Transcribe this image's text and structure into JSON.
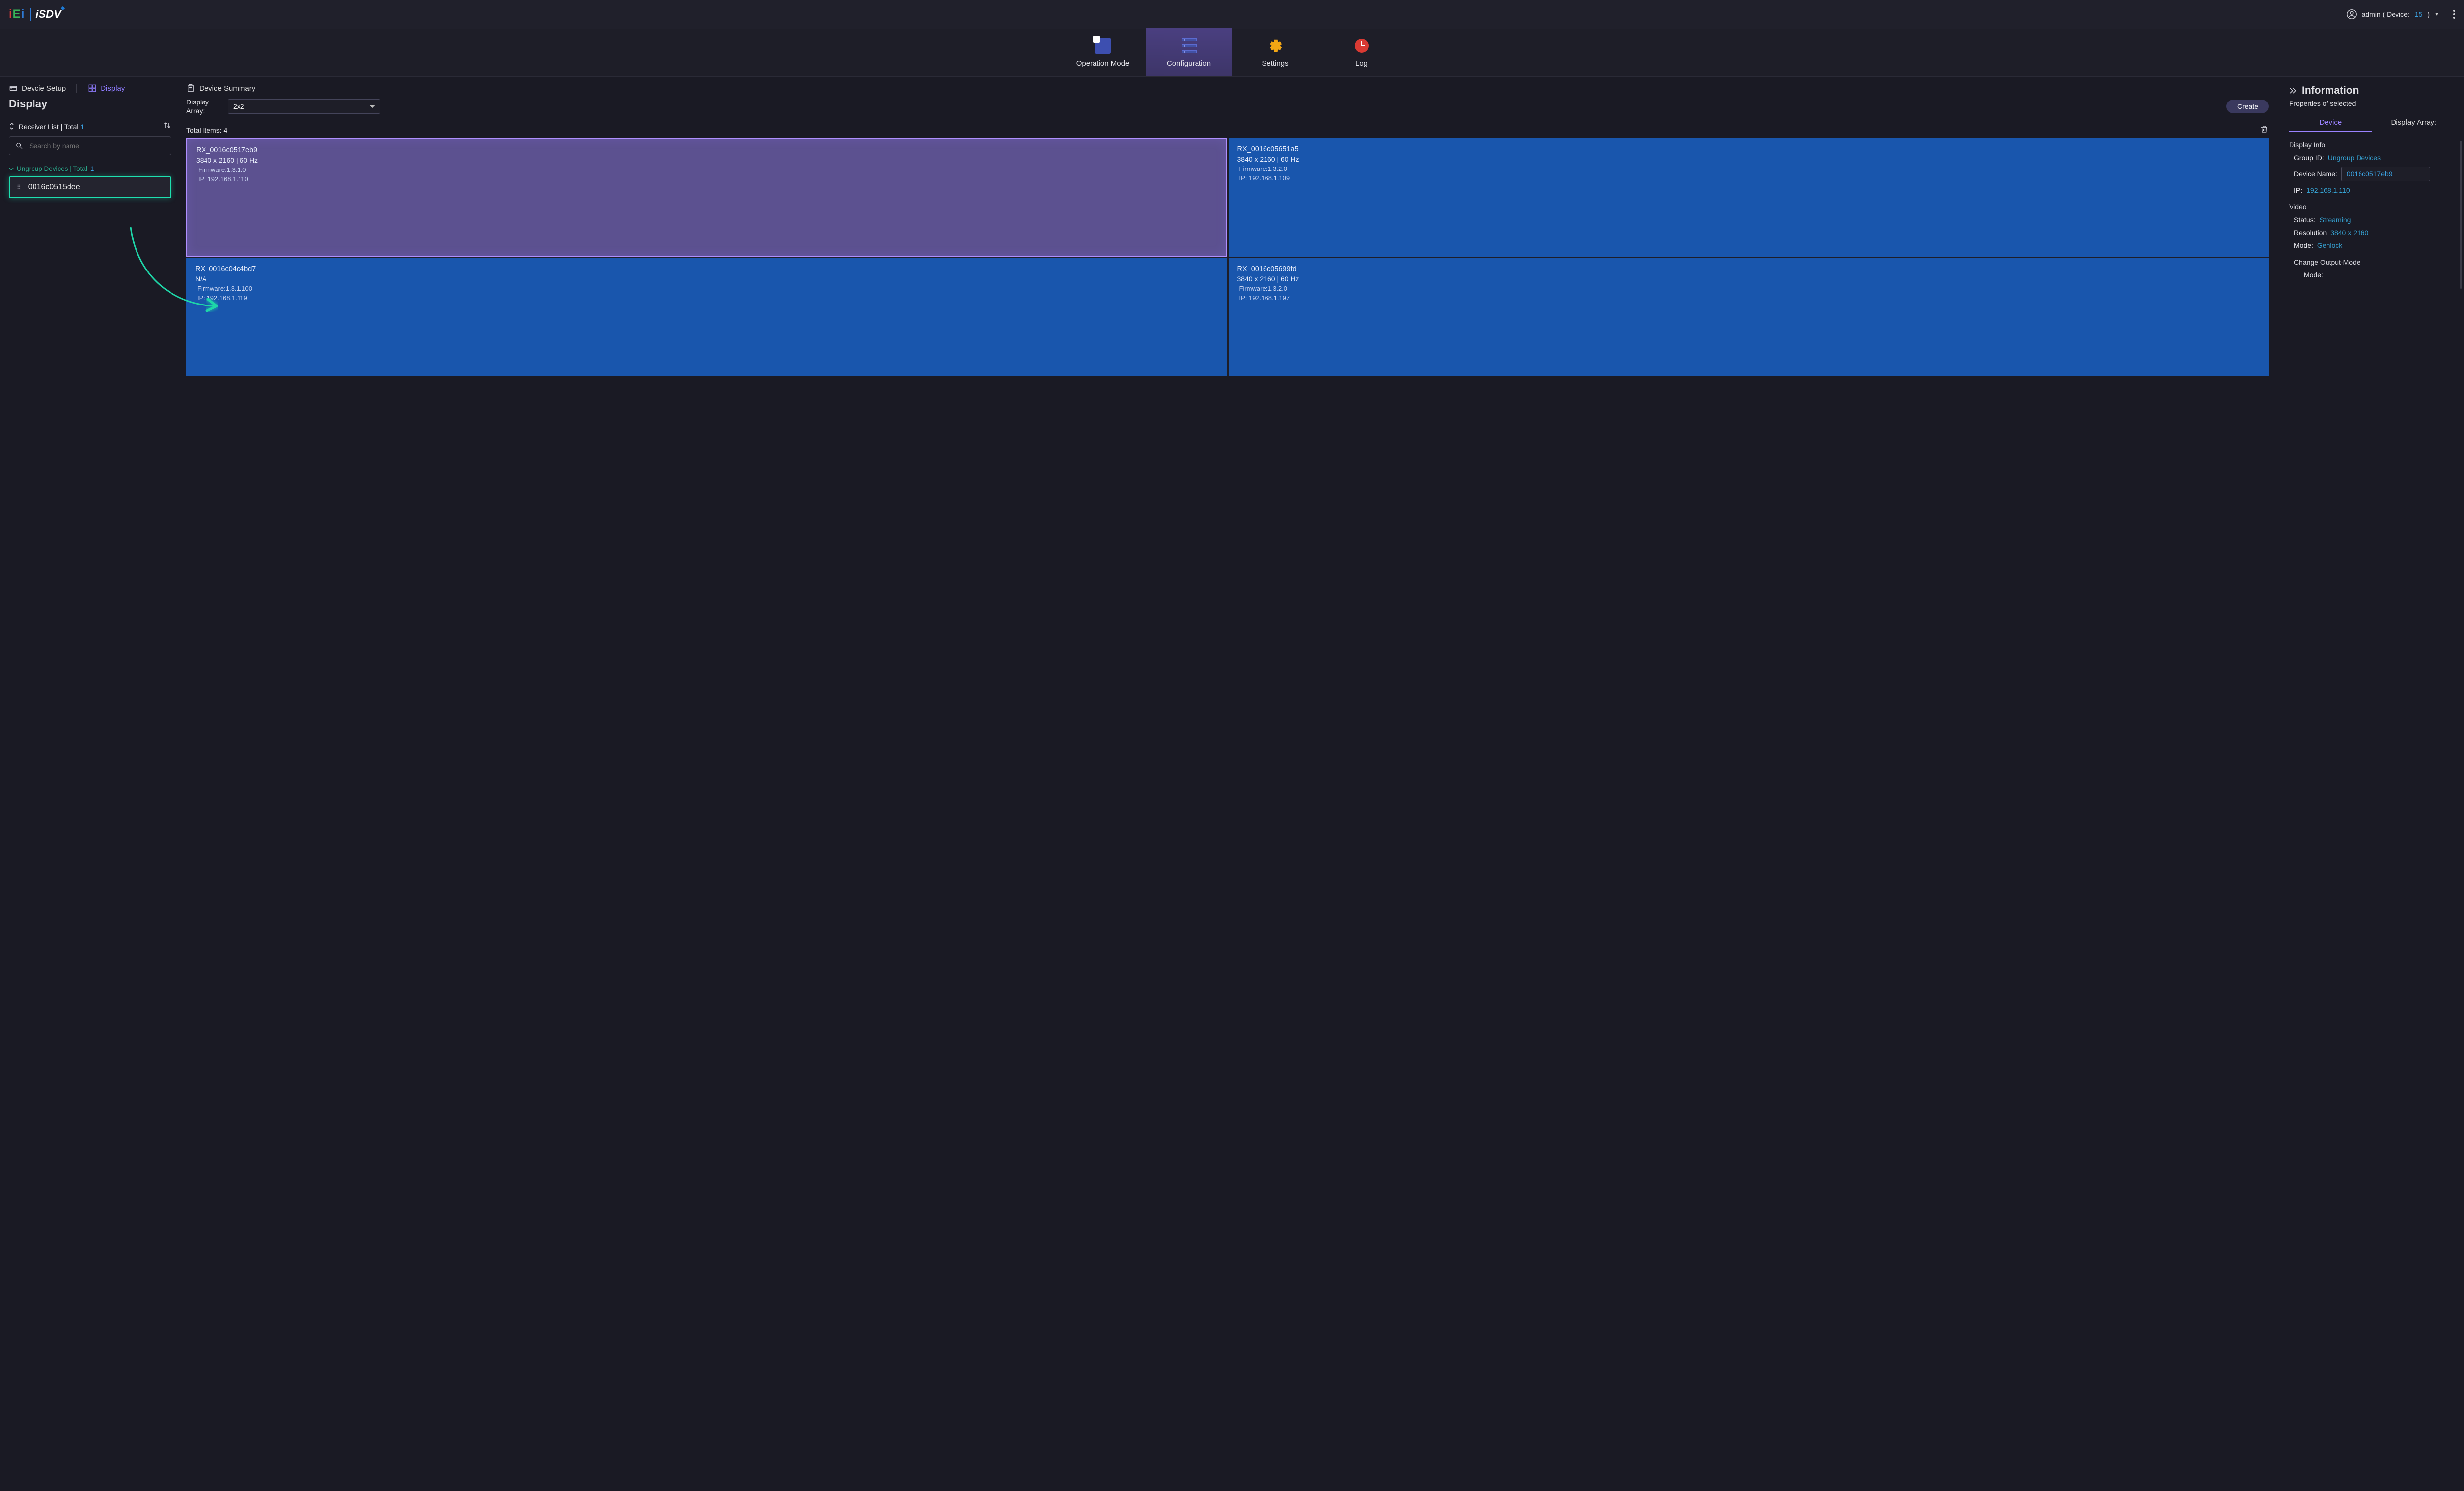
{
  "topbar": {
    "user_prefix": "admin ( Device:",
    "device_count": "15",
    "user_suffix": ")"
  },
  "mainnav": {
    "operation_mode": "Operation Mode",
    "configuration": "Configuration",
    "settings": "Settings",
    "log": "Log"
  },
  "subtabs": {
    "device_setup": "Devcie Setup",
    "display": "Display",
    "device_summary": "Device Summary"
  },
  "sidebar": {
    "title": "Display",
    "receiver_list_label": "Receiver List | Total",
    "receiver_total": "1",
    "search_placeholder": "Search by name",
    "group_label": "Ungroup Devices | Total",
    "group_total": "1",
    "device_name": "0016c0515dee"
  },
  "center": {
    "display_array_label": "Display Array:",
    "display_array_value": "2x2",
    "create_btn": "Create",
    "total_items_label": "Total Items:",
    "total_items_value": "4",
    "cells": [
      {
        "name": "RX_0016c0517eb9",
        "res": "3840 x 2160 | 60 Hz",
        "fw": "Firmware:1.3.1.0",
        "ip": "IP: 192.168.1.110",
        "selected": true
      },
      {
        "name": "RX_0016c05651a5",
        "res": "3840 x 2160 | 60 Hz",
        "fw": "Firmware:1.3.2.0",
        "ip": "IP: 192.168.1.109",
        "selected": false
      },
      {
        "name": "RX_0016c04c4bd7",
        "res": "N/A",
        "fw": "Firmware:1.3.1.100",
        "ip": "IP: 192.168.1.119",
        "selected": false
      },
      {
        "name": "RX_0016c05699fd",
        "res": "3840 x 2160 | 60 Hz",
        "fw": "Firmware:1.3.2.0",
        "ip": "IP: 192.168.1.197",
        "selected": false
      }
    ]
  },
  "info": {
    "heading": "Information",
    "subtitle": "Properties of selected",
    "tab_device": "Device",
    "tab_array": "Display Array:",
    "display_info_label": "Display Info",
    "group_id_k": "Group ID:",
    "group_id_v": "Ungroup Devices",
    "device_name_k": "Device Name:",
    "device_name_v": "0016c0517eb9",
    "ip_k": "IP:",
    "ip_v": "192.168.1.110",
    "video_label": "Video",
    "status_k": "Status:",
    "status_v": "Streaming",
    "resolution_k": "Resolution",
    "resolution_v": "3840 x 2160",
    "mode_k": "Mode:",
    "mode_v": "Genlock",
    "change_output_label": "Change Output-Mode",
    "out_mode_k": "Mode:"
  }
}
